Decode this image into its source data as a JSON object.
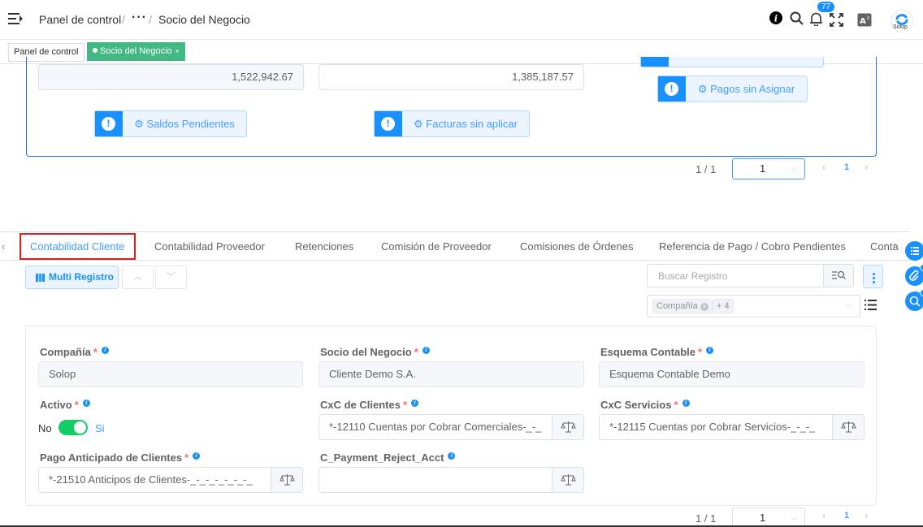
{
  "header": {
    "breadcrumb_root": "Panel de control",
    "breadcrumb_sep": "/",
    "breadcrumb_ellipsis": "···",
    "breadcrumb_current": "Socio del Negocio",
    "notification_count": "77",
    "logo_text": "Solop"
  },
  "tags": {
    "panel": "Panel de control",
    "socio": "Socio del Negocio",
    "close": "×"
  },
  "upper": {
    "amount_left": "1,522,942.67",
    "amount_mid": "1,385,187.57",
    "btn_saldos": "Saldos Pendientes",
    "btn_facturas": "Facturas sin aplicar",
    "btn_pagos": "Pagos sin Asignar",
    "pager_count": "1 / 1",
    "pager_page": "1",
    "pager_num": "1"
  },
  "tabs": [
    "Contabilidad Cliente",
    "Contabilidad Proveedor",
    "Retenciones",
    "Comisión de Proveedor",
    "Comisiones de Órdenes",
    "Referencia de Pago / Cobro Pendientes",
    "Conta"
  ],
  "toolbar": {
    "multi_label": "Multi Registro",
    "search_placeholder": "Buscar Registro",
    "filter_chip": "Compañía",
    "filter_more": "+ 4"
  },
  "form": {
    "company_label": "Compañía",
    "company_value": "Solop",
    "partner_label": "Socio del Negocio",
    "partner_value": "Cliente Demo S.A.",
    "schema_label": "Esquema Contable",
    "schema_value": "Esquema Contable Demo",
    "active_label": "Activo",
    "active_no": "No",
    "active_yes": "Si",
    "cxc_clientes_label": "CxC de Clientes",
    "cxc_clientes_value": "*-12110 Cuentas por Cobrar Comerciales-_-_",
    "cxc_servicios_label": "CxC Servicios",
    "cxc_servicios_value": "*-12115 Cuentas por Cobrar Servicios-_-_-_",
    "anticipado_label": "Pago Anticipado de Clientes",
    "anticipado_value": "*-21510 Anticipos de Clientes-_-_-_-_-_-_-_",
    "reject_label": "C_Payment_Reject_Acct",
    "reject_value": ""
  },
  "lower_pager": {
    "count": "1 / 1",
    "page": "1",
    "num": "1"
  },
  "colors": {
    "primary": "#1890ff",
    "success": "#13ce66",
    "tag_active": "#42b983",
    "danger": "#f56c6c",
    "highlight": "#d62020"
  }
}
